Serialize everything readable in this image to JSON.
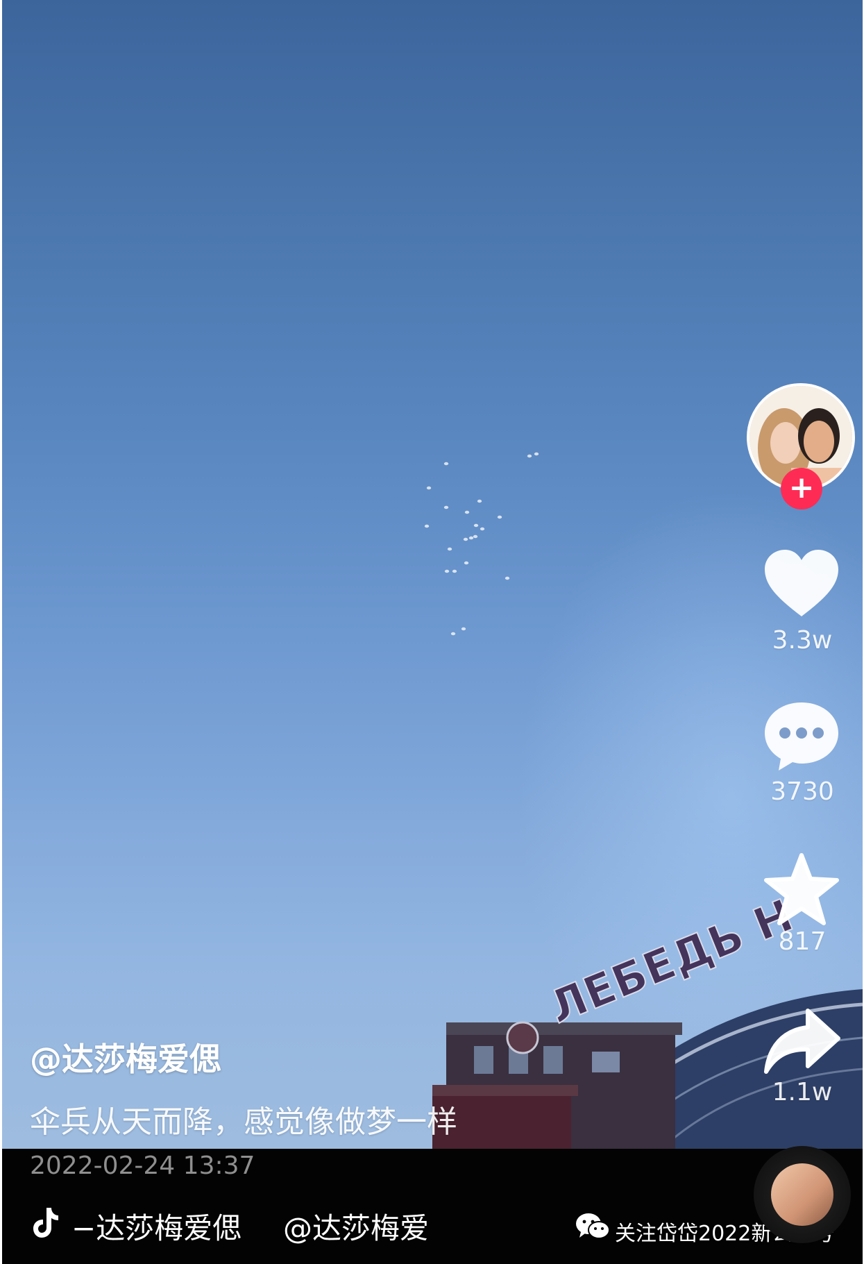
{
  "video": {
    "author_handle": "@达莎梅爱偲",
    "caption": "伞兵从天而降，感觉像做梦一样",
    "timestamp": "2022-02-24 13:37",
    "building_sign_text": "ЛЕБЕДЬ Н"
  },
  "sidebar": {
    "follow_label": "+",
    "likes_count": "3.3w",
    "comments_count": "3730",
    "favorites_count": "817",
    "shares_count": "1.1w"
  },
  "watermark": {
    "platform_user": "−达莎梅爱偲",
    "platform_handle": "@达莎梅爱",
    "wechat_text": "关注岱岱2022新公众号"
  },
  "icons": {
    "like": "heart-icon",
    "comment": "comment-bubble-icon",
    "favorite": "star-icon",
    "share": "share-arrow-icon",
    "platform": "tiktok-logo-icon",
    "wechat": "wechat-icon"
  },
  "colors": {
    "follow_accent": "#fe2c55",
    "sky_top": "#3c659c",
    "sky_bottom": "#9ebcdf",
    "bar_background": "#030303"
  }
}
